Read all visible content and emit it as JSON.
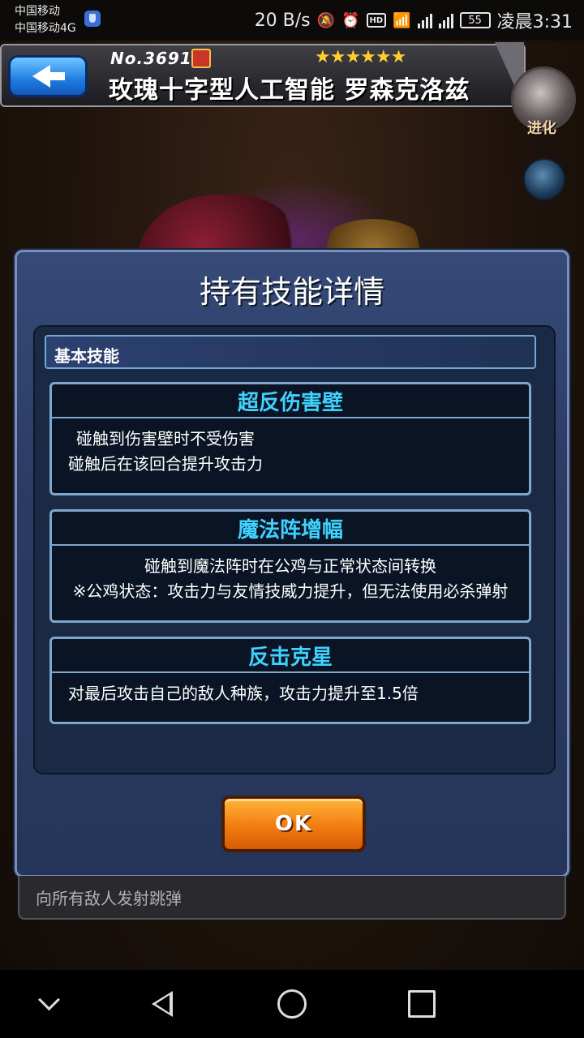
{
  "status_bar": {
    "carrier_1": "中国移动",
    "carrier_2": "中国移动4G",
    "net_speed": "20 B/s",
    "hd": "HD",
    "battery": "55",
    "time": "凌晨3:31"
  },
  "header": {
    "unit_number": "No.3691",
    "stars": "★★★★★★",
    "unit_name": "玫瑰十字型人工智能 罗森克洛兹",
    "evolve_label": "进化"
  },
  "dialog": {
    "title": "持有技能详情",
    "section_label": "基本技能",
    "skills": [
      {
        "name": "超反伤害壁",
        "desc_lines": [
          "碰触到伤害壁时不受伤害",
          "碰触后在该回合提升攻击力"
        ]
      },
      {
        "name": "魔法阵增幅",
        "desc_lines": [
          "碰触到魔法阵时在公鸡与正常状态间转换",
          "※公鸡状态：攻击力与友情技威力提升，但无法使用必杀弹射"
        ]
      },
      {
        "name": "反击克星",
        "desc_lines": [
          "对最后攻击自己的敌人种族，攻击力提升至1.5倍"
        ]
      }
    ],
    "ok_label": "OK"
  },
  "bottom_strip": {
    "text": "向所有敌人发射跳弹"
  },
  "colors": {
    "skill_name": "#3fd2ff",
    "ok_button": "#f27c10",
    "dialog_bg": "#2a3b63",
    "back_button": "#1f7ce0"
  },
  "icons": [
    "shield-icon",
    "mute-icon",
    "alarm-icon",
    "hd-icon",
    "wifi-icon",
    "signal-icon",
    "battery-icon",
    "rarity-icon",
    "back-arrow-icon",
    "orb-icon"
  ]
}
